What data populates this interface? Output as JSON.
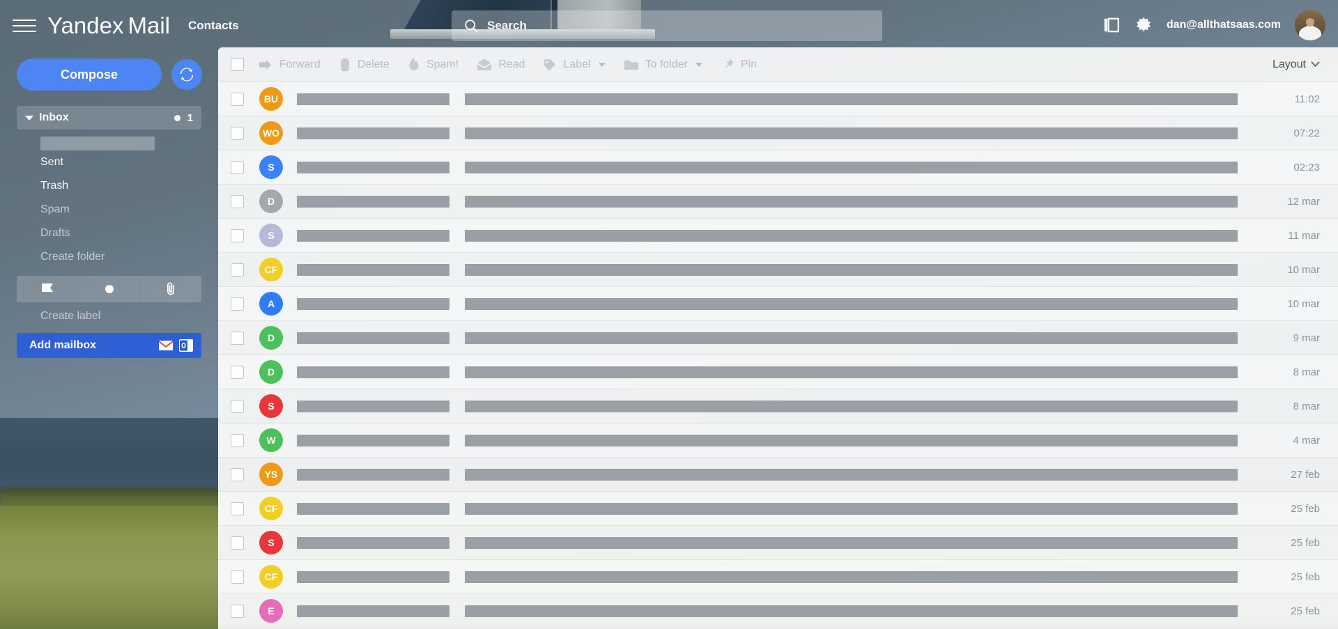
{
  "header": {
    "menu_icon": "hamburger-icon",
    "logo_primary": "Yandex",
    "logo_secondary": "Mail",
    "contacts_label": "Contacts",
    "search_placeholder": "Search",
    "search_value": "",
    "search_icon": "search-icon",
    "reading_pane_icon": "reading-pane-icon",
    "settings_icon": "gear-icon",
    "user_email": "dan@allthatsaas.com",
    "avatar_icon": "user-avatar"
  },
  "sidebar": {
    "compose_label": "Compose",
    "refresh_icon": "refresh-icon",
    "inbox": {
      "label": "Inbox",
      "caret_icon": "caret-down-icon",
      "unread_dot": true,
      "count": "1"
    },
    "folders": [
      {
        "label": "Sent",
        "dim": false
      },
      {
        "label": "Trash",
        "dim": false
      },
      {
        "label": "Spam",
        "dim": true
      },
      {
        "label": "Drafts",
        "dim": true
      },
      {
        "label": "Create folder",
        "dim": true
      }
    ],
    "label_buttons": [
      {
        "icon": "flag-icon"
      },
      {
        "icon": "dot-icon"
      },
      {
        "icon": "paperclip-icon"
      }
    ],
    "create_label": "Create label",
    "add_mailbox_label": "Add mailbox",
    "providers": [
      {
        "icon": "gmail-icon"
      },
      {
        "icon": "outlook-icon"
      }
    ]
  },
  "toolbar": {
    "select_all_checkbox": false,
    "items": [
      {
        "label": "Forward",
        "icon": "forward-arrow-icon",
        "caret": false
      },
      {
        "label": "Delete",
        "icon": "trash-icon",
        "caret": false
      },
      {
        "label": "Spam!",
        "icon": "fire-icon",
        "caret": false
      },
      {
        "label": "Read",
        "icon": "envelope-open-icon",
        "caret": false
      },
      {
        "label": "Label",
        "icon": "tag-icon",
        "caret": true
      },
      {
        "label": "To folder",
        "icon": "folder-icon",
        "caret": true
      },
      {
        "label": "Pin",
        "icon": "pin-icon",
        "caret": false
      }
    ],
    "layout_label": "Layout",
    "layout_caret_icon": "chevron-down-icon"
  },
  "colors": {
    "accent_blue": "#4d86f4",
    "add_mailbox_blue": "#2f5fd4",
    "redacted_gray": "#9aa0a6",
    "sidebar_base": "#5d6e7b"
  },
  "messages": [
    {
      "initials": "BU",
      "color": "#ef9a16",
      "date": "11:02"
    },
    {
      "initials": "WO",
      "color": "#ef9a16",
      "date": "07:22"
    },
    {
      "initials": "S",
      "color": "#3b82f6",
      "date": "02:23"
    },
    {
      "initials": "D",
      "color": "#a3a8ac",
      "date": "12 mar"
    },
    {
      "initials": "S",
      "color": "#b5bad8",
      "date": "11 mar"
    },
    {
      "initials": "CF",
      "color": "#f2ce26",
      "date": "10 mar"
    },
    {
      "initials": "A",
      "color": "#2f7df4",
      "date": "10 mar"
    },
    {
      "initials": "D",
      "color": "#4cc05a",
      "date": "9 mar"
    },
    {
      "initials": "D",
      "color": "#4cc05a",
      "date": "8 mar"
    },
    {
      "initials": "S",
      "color": "#e8363a",
      "date": "8 mar"
    },
    {
      "initials": "W",
      "color": "#4cc05a",
      "date": "4 mar"
    },
    {
      "initials": "YS",
      "color": "#ef9a16",
      "date": "27 feb"
    },
    {
      "initials": "CF",
      "color": "#f2ce26",
      "date": "25 feb"
    },
    {
      "initials": "S",
      "color": "#e8363a",
      "date": "25 feb"
    },
    {
      "initials": "CF",
      "color": "#f2ce26",
      "date": "25 feb"
    },
    {
      "initials": "E",
      "color": "#e86bb8",
      "date": "25 feb"
    }
  ]
}
